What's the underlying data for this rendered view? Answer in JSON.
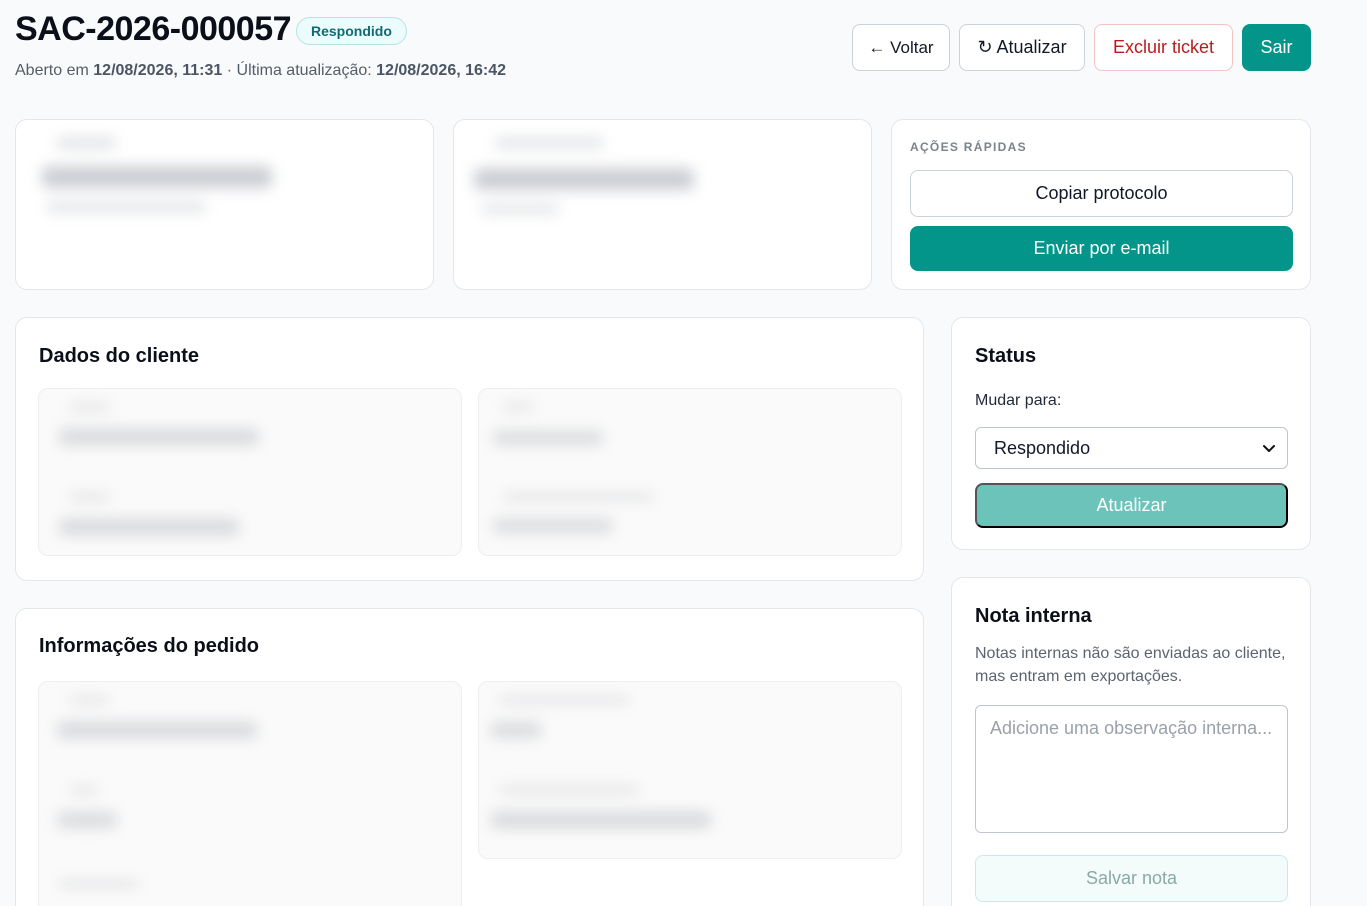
{
  "header": {
    "ticket_id": "SAC-2026-000057",
    "status_badge": "Respondido",
    "opened_prefix": "Aberto em",
    "opened_at": "12/08/2026, 11:31",
    "separator": "·",
    "updated_prefix": "Última atualização:",
    "updated_at": "12/08/2026, 16:42"
  },
  "toolbar": {
    "back_label": "← Voltar",
    "refresh_label": "↻ Atualizar",
    "delete_label": "Excluir ticket",
    "logout_label": "Sair"
  },
  "quick_actions": {
    "title": "AÇÕES RÁPIDAS",
    "copy_label": "Copiar protocolo",
    "email_label": "Enviar por e-mail"
  },
  "cliente": {
    "title": "Dados do cliente"
  },
  "pedido": {
    "title": "Informações do pedido"
  },
  "status": {
    "title": "Status",
    "change_label": "Mudar para:",
    "selected": "Respondido",
    "update_label": "Atualizar"
  },
  "nota": {
    "title": "Nota interna",
    "description": "Notas internas não são enviadas ao cliente, mas entram em exportações.",
    "placeholder": "Adicione uma observação interna...",
    "save_label": "Salvar nota"
  },
  "colors": {
    "primary": "#04958a",
    "danger": "#b91c1c",
    "badge_bg": "#ecfbfb"
  }
}
